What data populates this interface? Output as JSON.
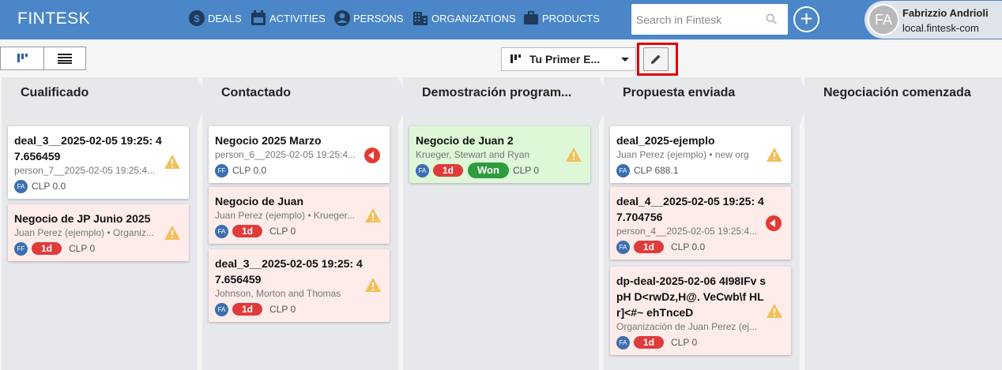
{
  "app": {
    "brand": "FINTESK"
  },
  "nav": {
    "deals": "DEALS",
    "activities": "ACTIVITIES",
    "persons": "PERSONS",
    "organizations": "ORGANIZATIONS",
    "products": "PRODUCTS"
  },
  "search": {
    "placeholder": "Search in Fintesk",
    "value": ""
  },
  "user": {
    "initials": "FA",
    "name": "Fabrizzio Andrioli",
    "domain": "local.fintesk-com"
  },
  "toolbar": {
    "pipeline": "Tu Primer E..."
  },
  "colors": {
    "header": "#4a86c8",
    "overdue": "#e03b3b",
    "won": "#2e9b3c",
    "warning": "#f2c05a"
  },
  "stages": [
    {
      "title": "Cualificado",
      "cards": [
        {
          "title": "deal_3__2025-02-05 19:25: 47.656459",
          "sub": "person_7__2025-02-05 19:25:4...",
          "avatar": "FA",
          "badge": "",
          "won": "",
          "value": "CLP 0.0",
          "icon": "warning-icon",
          "bg": "white"
        },
        {
          "title": "Negocio de JP Junio 2025",
          "sub": "Juan Perez (ejemplo) • Organiz...",
          "avatar": "FF",
          "badge": "1d",
          "won": "",
          "value": "CLP 0",
          "icon": "warning-icon",
          "bg": "pink"
        }
      ]
    },
    {
      "title": "Contactado",
      "cards": [
        {
          "title": "Negocio 2025 Marzo",
          "sub": "person_6__2025-02-05 19:25:4...",
          "avatar": "FF",
          "badge": "",
          "won": "",
          "value": "CLP 0.0",
          "icon": "overdue-icon",
          "bg": "white"
        },
        {
          "title": "Negocio de Juan",
          "sub": "Juan Perez (ejemplo) • Krueger...",
          "avatar": "FA",
          "badge": "1d",
          "won": "",
          "value": "CLP 0",
          "icon": "warning-icon",
          "bg": "pink"
        },
        {
          "title": "deal_3__2025-02-05 19:25: 47.656459",
          "sub": "Johnson, Morton and Thomas",
          "avatar": "FA",
          "badge": "1d",
          "won": "",
          "value": "CLP 0",
          "icon": "warning-icon",
          "bg": "pink"
        }
      ]
    },
    {
      "title": "Demostración program...",
      "cards": [
        {
          "title": "Negocio de Juan 2",
          "sub": "Krueger, Stewart and Ryan",
          "avatar": "FA",
          "badge": "1d",
          "won": "Won",
          "value": "CLP 0",
          "icon": "warning-icon",
          "bg": "green"
        }
      ]
    },
    {
      "title": "Propuesta enviada",
      "cards": [
        {
          "title": "deal_2025-ejemplo",
          "sub": "Juan Perez (ejemplo) • new org",
          "avatar": "FA",
          "badge": "",
          "won": "",
          "value": "CLP 688.1",
          "icon": "warning-icon",
          "bg": "white"
        },
        {
          "title": "deal_4__2025-02-05 19:25: 47.704756",
          "sub": "person_4__2025-02-05 19:25:4...",
          "avatar": "FA",
          "badge": "1d",
          "won": "",
          "value": "CLP 0.0",
          "icon": "overdue-icon",
          "bg": "pink"
        },
        {
          "title": "dp-deal-2025-02-06 4I98IFv spH D<rwDz,H@. VeCwb\\f HLr]<#~ ehTnceD",
          "sub": "Organización de Juan Perez (ej...",
          "avatar": "FA",
          "badge": "1d",
          "won": "",
          "value": "CLP 0",
          "icon": "warning-icon",
          "bg": "pink"
        }
      ]
    },
    {
      "title": "Negociación comenzada",
      "cards": []
    }
  ]
}
